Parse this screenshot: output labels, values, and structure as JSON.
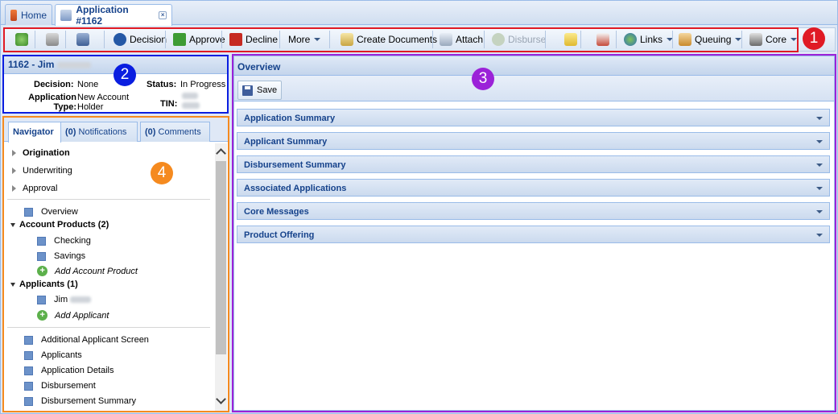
{
  "tabs": [
    {
      "label": "Home",
      "icon": "calendar-home-icon"
    },
    {
      "label": "Application #1162",
      "icon": "edit-document-icon",
      "close": "×"
    }
  ],
  "toolbar": {
    "refresh_icon": "refresh-icon",
    "print_icon": "print-icon",
    "calculator_icon": "calculator-icon",
    "decision": "Decision",
    "approve": "Approve",
    "decline": "Decline",
    "more": "More",
    "create_documents": "Create Documents",
    "attach": "Attach",
    "disburse": "Disburse",
    "notes_icon": "notes-icon",
    "mail_icon": "mail-icon",
    "links": "Links",
    "queuing": "Queuing",
    "core": "Core"
  },
  "callouts": [
    "1",
    "2",
    "3",
    "4"
  ],
  "callout_colors": {
    "1": "#e01a24",
    "2": "#0a1ee0",
    "3": "#9b22d8",
    "4": "#f58a1f"
  },
  "info": {
    "title": "1162 - Jim",
    "decision_label": "Decision:",
    "decision_value": "None",
    "status_label": "Status:",
    "status_value": "In Progress",
    "app_type_label_1": "Application",
    "app_type_label_2": "Type:",
    "app_type_value_1": "New Account",
    "app_type_value_2": "Holder",
    "tin_label": "TIN:"
  },
  "navigator": {
    "tabs": [
      {
        "label": "Navigator"
      },
      {
        "count": "(0)",
        "label": "Notifications"
      },
      {
        "count": "(0)",
        "label": "Comments"
      }
    ],
    "stages": [
      "Origination",
      "Underwriting",
      "Approval"
    ],
    "overview": "Overview",
    "account_products_header": "Account Products (2)",
    "account_products": [
      "Checking",
      "Savings"
    ],
    "add_account_product": "Add Account Product",
    "applicants_header": "Applicants (1)",
    "applicant_first_name": "Jim",
    "add_applicant": "Add Applicant",
    "screens": [
      "Additional Applicant Screen",
      "Applicants",
      "Application Details",
      "Disbursement",
      "Disbursement Summary"
    ]
  },
  "main": {
    "title": "Overview",
    "save": "Save",
    "sections": [
      "Application Summary",
      "Applicant Summary",
      "Disbursement Summary",
      "Associated Applications",
      "Core Messages",
      "Product Offering"
    ]
  }
}
